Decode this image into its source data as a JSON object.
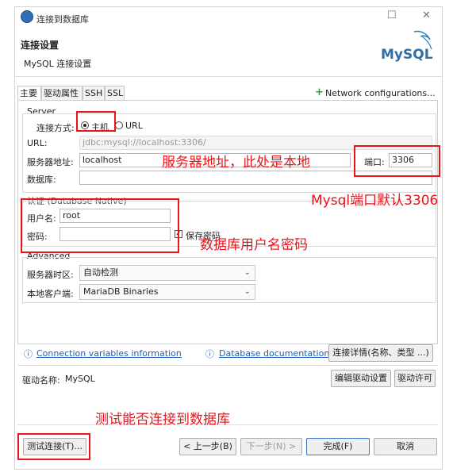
{
  "window": {
    "title": "连接到数据库"
  },
  "header": {
    "title": "连接设置",
    "subtitle": "MySQL 连接设置",
    "logo_text": "MySQL"
  },
  "tabs": [
    "主要",
    "驱动属性",
    "SSH",
    "SSL"
  ],
  "network_config": "Network configurations...",
  "server": {
    "group_title": "Server",
    "connect_mode_label": "连接方式:",
    "mode_host": "主机",
    "mode_url": "URL",
    "url_label": "URL:",
    "url_value": "jdbc:mysql://localhost:3306/",
    "host_label": "服务器地址:",
    "host_value": "localhost",
    "port_label": "端口:",
    "port_value": "3306",
    "db_label": "数据库:",
    "db_value": ""
  },
  "auth": {
    "group_title": "认证 (Database Native)",
    "user_label": "用户名:",
    "user_value": "root",
    "pass_label": "密码:",
    "pass_value": "",
    "save_password": "保存密码"
  },
  "advanced": {
    "group_title": "Advanced",
    "tz_label": "服务器时区:",
    "tz_value": "自动检测",
    "client_label": "本地客户端:",
    "client_value": "MariaDB Binaries"
  },
  "links": {
    "conn_vars": "Connection variables information",
    "db_docs": "Database documentation",
    "conn_details": "连接详情(名称、类型 ...)"
  },
  "driver": {
    "name_label": "驱动名称:",
    "name_value": "MySQL",
    "edit_button": "编辑驱动设置",
    "license_button": "驱动许可"
  },
  "footer": {
    "test": "测试连接(T)...",
    "prev": "< 上一步(B)",
    "next": "下一步(N) >",
    "finish": "完成(F)",
    "cancel": "取消"
  },
  "annotations": {
    "host_note": "服务器地址，此处是本地",
    "port_note": "Mysql端口默认3306",
    "user_note": "数据库用户名密码",
    "test_note": "测试能否连接到数据库"
  },
  "colors": {
    "annotation_red": "#e8141c",
    "link_blue": "#1d5bb8"
  }
}
